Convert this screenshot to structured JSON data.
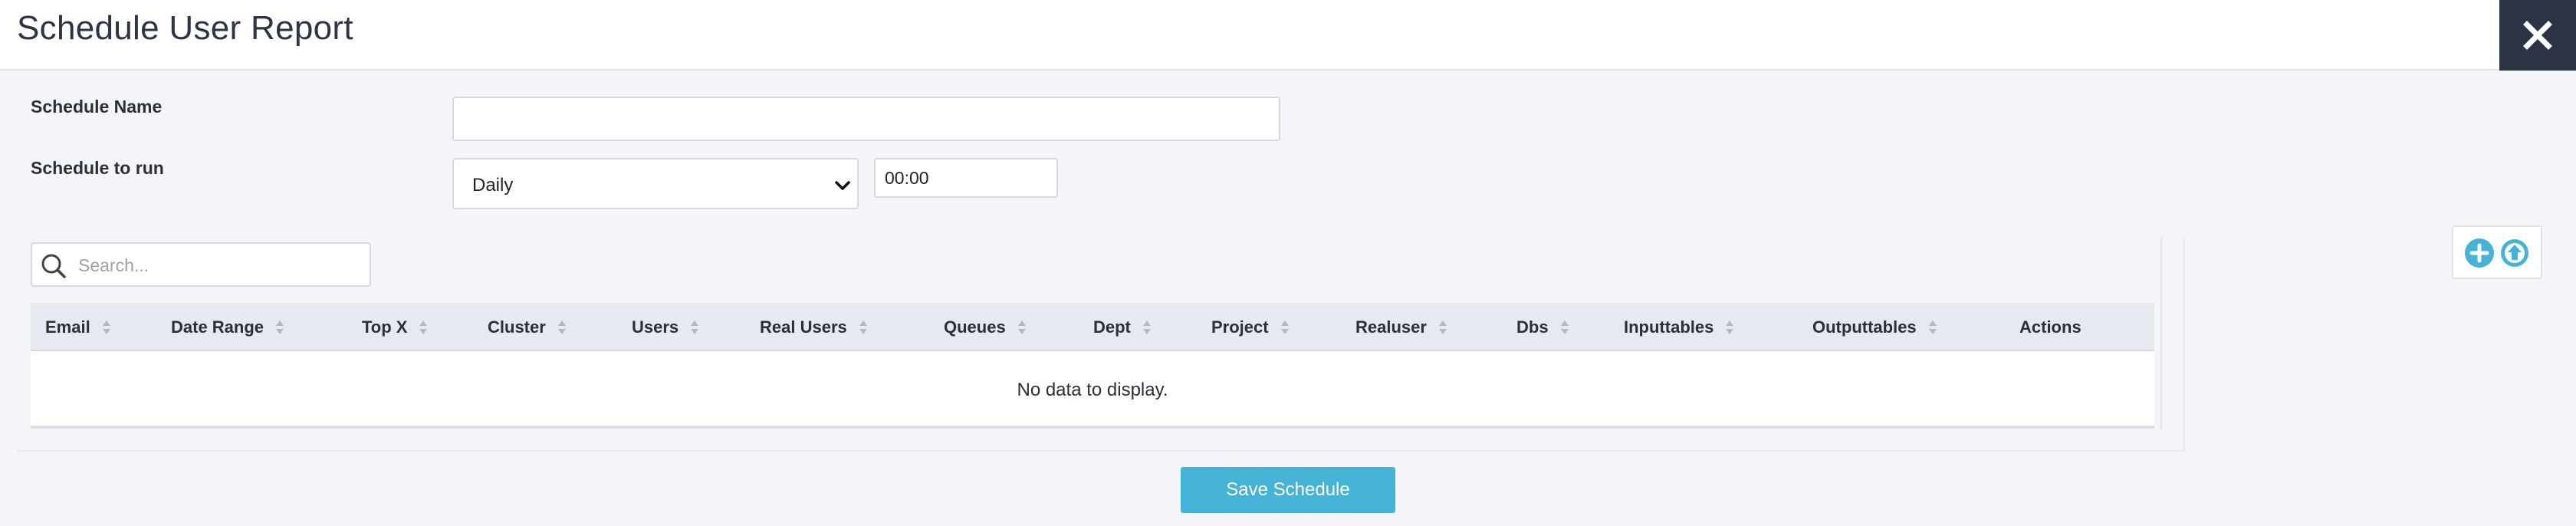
{
  "header": {
    "title": "Schedule User Report",
    "close_icon": "close-icon"
  },
  "form": {
    "schedule_name_label": "Schedule Name",
    "schedule_name_value": "",
    "schedule_name_placeholder": "",
    "schedule_run_label": "Schedule to run",
    "frequency_value": "Daily",
    "time_value": "00:00"
  },
  "search": {
    "placeholder": "Search...",
    "icon": "search-icon"
  },
  "table": {
    "columns": [
      "Email",
      "Date Range",
      "Top X",
      "Cluster",
      "Users",
      "Real Users",
      "Queues",
      "Dept",
      "Project",
      "Realuser",
      "Dbs",
      "Inputtables",
      "Outputtables",
      "Actions"
    ],
    "empty_text": "No data to display."
  },
  "toolbar": {
    "add_icon": "plus-circle-icon",
    "upload_icon": "upload-circle-icon"
  },
  "footer": {
    "save_label": "Save Schedule"
  },
  "colors": {
    "accent": "#45b3d6",
    "header_dark": "#2c3345",
    "table_header_bg": "#e6e9ef"
  }
}
